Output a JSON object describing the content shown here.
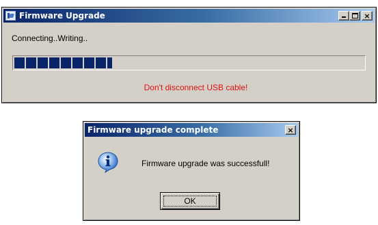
{
  "firmware_window": {
    "title": "Firmware Upgrade",
    "status_text": "Connecting..Writing..",
    "progress_fraction": 0.28,
    "warning_text": "Don't disconnect USB cable!",
    "icon": "firmware-app-icon",
    "controls": {
      "minimize_icon": "minimize-icon",
      "maximize_icon": "maximize-icon",
      "close_glyph": "×"
    }
  },
  "complete_dialog": {
    "title": "Firmware upgrade complete",
    "message": "Firmware upgrade was successfull!",
    "icon": "info-icon",
    "ok_label": "OK",
    "close_glyph": "×"
  },
  "colors": {
    "titlebar_start": "#0a246a",
    "titlebar_end": "#a6caf0",
    "progress_block": "#0a246a",
    "warning": "#e01010",
    "window_face": "#d4d0c8"
  }
}
